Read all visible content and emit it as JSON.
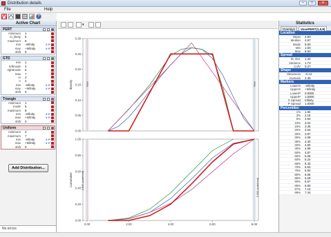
{
  "window": {
    "title": "Distribution details",
    "controls": [
      "–",
      "□",
      "✕"
    ]
  },
  "menu": {
    "items": [
      "File",
      "Help"
    ]
  },
  "toolbar": {
    "icons": [
      "red-curve-icon",
      "fit-icon",
      "book-icon",
      "table-icon",
      "chart-icon",
      "help-icon"
    ]
  },
  "left_panel": {
    "title": "Active Chart",
    "distributions": [
      {
        "name": "PERT",
        "selected": false,
        "color": "#2f63b6",
        "params": [
          {
            "label": "minimum",
            "value": "1"
          },
          {
            "label": "m_likely",
            "value": "5"
          },
          {
            "label": "maximum",
            "value": "8"
          },
          {
            "label": "min",
            "value": "-Infinity",
            "fx": true
          },
          {
            "label": "max",
            "value": "+Infinity",
            "fx": true
          },
          {
            "label": "shift",
            "value": "0"
          }
        ]
      },
      {
        "name": "GTD",
        "selected": false,
        "color": "#1a8f3c",
        "params": [
          {
            "label": "min",
            "value": "1"
          },
          {
            "label": "leftmode",
            "value": "4"
          },
          {
            "label": "rightmode",
            "value": "6"
          },
          {
            "label": "max",
            "value": "7"
          },
          {
            "label": "m",
            "value": "2"
          },
          {
            "label": "n",
            "value": "2"
          },
          {
            "label": "min",
            "value": "-Infinity",
            "fx": true
          },
          {
            "label": "max",
            "value": "+Infinity",
            "fx": true
          },
          {
            "label": "shift",
            "value": "0"
          }
        ]
      },
      {
        "name": "Triangle",
        "selected": false,
        "color": "#c0388a",
        "params": [
          {
            "label": "minimum",
            "value": "1"
          },
          {
            "label": "mode",
            "value": "5"
          },
          {
            "label": "maximum",
            "value": "8"
          },
          {
            "label": "min",
            "value": "-Infinity",
            "fx": true
          },
          {
            "label": "max",
            "value": "+Infinity",
            "fx": true
          },
          {
            "label": "shift",
            "value": "0"
          }
        ]
      },
      {
        "name": "Uniform",
        "selected": true,
        "color": "#d11a1a",
        "params": [
          {
            "label": "minimum",
            "value": "2"
          },
          {
            "label": "maximum",
            "value": "7"
          },
          {
            "label": "min",
            "value": "-Infinity",
            "fx": true
          },
          {
            "label": "max",
            "value": "+Infinity",
            "fx": true
          },
          {
            "label": "shift",
            "value": "0"
          }
        ]
      }
    ],
    "add_button": "Add Distribution...",
    "status": "No errors"
  },
  "chart_toolbar": {
    "icons": [
      "copy-icon",
      "print-icon",
      "edit-icon",
      "dropdown-icon",
      "stats-icon",
      "flag-icon"
    ]
  },
  "chart_data": [
    {
      "type": "line",
      "ylabel": "density",
      "xlim": [
        -0.2,
        8.2
      ],
      "ylim": [
        0,
        0.3
      ],
      "yticks": [
        "0.00",
        "0.05",
        "0.10",
        "0.15",
        "0.20",
        "0.25",
        "0.30"
      ],
      "grid": false,
      "series": [
        {
          "color": "#2f63b6",
          "x": [
            1,
            1.5,
            2,
            2.5,
            3,
            3.5,
            4,
            4.5,
            5,
            5.5,
            6,
            6.5,
            7,
            7.5,
            8
          ],
          "y": [
            0,
            0.015,
            0.045,
            0.085,
            0.13,
            0.175,
            0.215,
            0.25,
            0.27,
            0.265,
            0.235,
            0.18,
            0.11,
            0.04,
            0
          ]
        },
        {
          "color": "#1a8f3c",
          "x": [
            1,
            2,
            3,
            4,
            4.5,
            5,
            5.5,
            6,
            6.5,
            7
          ],
          "y": [
            0,
            0.07,
            0.15,
            0.245,
            0.265,
            0.27,
            0.265,
            0.245,
            0.14,
            0
          ]
        },
        {
          "color": "#c0388a",
          "x": [
            1,
            5,
            8
          ],
          "y": [
            0,
            0.286,
            0
          ]
        },
        {
          "color": "#d11a1a",
          "x": [
            1,
            2,
            4,
            6,
            7,
            8
          ],
          "y": [
            0,
            0,
            0.25,
            0.25,
            0,
            0
          ]
        }
      ]
    },
    {
      "type": "line",
      "ylabel": "cumulative",
      "xlim": [
        -0.2,
        8.2
      ],
      "ylim": [
        0,
        1
      ],
      "yticks": [
        "0.00",
        "0.20",
        "0.40",
        "0.60",
        "0.80",
        "1.00"
      ],
      "xticks": [
        "0.00",
        "2.00",
        "4.00",
        "6.00",
        "8.00"
      ],
      "grid": false,
      "series": [
        {
          "color": "#2f63b6",
          "x": [
            1,
            2,
            3,
            4,
            5,
            6,
            7,
            8
          ],
          "y": [
            0,
            0.02,
            0.1,
            0.27,
            0.51,
            0.77,
            0.95,
            1
          ]
        },
        {
          "color": "#1a8f3c",
          "x": [
            1,
            2,
            3,
            4,
            5,
            6,
            7
          ],
          "y": [
            0,
            0.03,
            0.14,
            0.34,
            0.6,
            0.86,
            1
          ]
        },
        {
          "color": "#c0388a",
          "x": [
            1,
            2,
            3,
            4,
            5,
            6,
            7,
            8
          ],
          "y": [
            0,
            0.02,
            0.1,
            0.21,
            0.38,
            0.6,
            0.82,
            1
          ]
        },
        {
          "color": "#d11a1a",
          "x": [
            1,
            2,
            3,
            4,
            5,
            6,
            7,
            8
          ],
          "y": [
            0,
            0,
            0.06,
            0.2,
            0.45,
            0.72,
            0.94,
            1
          ]
        }
      ]
    }
  ],
  "chart_markers": {
    "left": "0.000 (undefined)",
    "right": "9.000 (undefined)",
    "left_small": "Mean",
    "right_small": "Mean"
  },
  "right_panel": {
    "title": "Statistics",
    "tabs": [
      "Overlays",
      "VosePERT(1,5,8)"
    ],
    "sections": [
      {
        "name": "Location",
        "rows": [
          {
            "label": "Mean",
            "value": "4.83"
          },
          {
            "label": "Median",
            "value": "4.87"
          },
          {
            "label": "Mode",
            "value": "5.00"
          },
          {
            "label": "Min",
            "value": "1.00"
          },
          {
            "label": "Max",
            "value": "8.00"
          }
        ]
      },
      {
        "name": "Spread",
        "rows": [
          {
            "label": "St. dev.",
            "value": "1.32"
          },
          {
            "label": "Variance",
            "value": "1.73"
          },
          {
            "label": "CofV",
            "value": "0.27"
          }
        ]
      },
      {
        "name": "Shape",
        "rows": [
          {
            "label": "Skewness",
            "value": "-0.13"
          },
          {
            "label": "Kurtosis",
            "value": "2.35"
          }
        ]
      },
      {
        "name": "Markers",
        "rows": [
          {
            "label": "LowerX",
            "value": "-Infinity"
          },
          {
            "label": "UpperX",
            "value": "+Infinity"
          },
          {
            "label": "LowerP",
            "value": "0.0000"
          },
          {
            "label": "UpperP",
            "value": "1.0000"
          },
          {
            "label": "X Spread",
            "value": "Infinity"
          },
          {
            "label": "P Spread",
            "value": "1.0000"
          }
        ]
      }
    ],
    "percentiles_title": "Percentiles",
    "percentiles": [
      {
        "label": "1%",
        "value": "1.94"
      },
      {
        "label": "3%",
        "value": "2.15"
      },
      {
        "label": "5%",
        "value": "2.60"
      },
      {
        "label": "10%",
        "value": "3.04"
      },
      {
        "label": "15%",
        "value": "3.36"
      },
      {
        "label": "20%",
        "value": "3.63"
      },
      {
        "label": "25%",
        "value": "3.87"
      },
      {
        "label": "30%",
        "value": "4.09"
      },
      {
        "label": "35%",
        "value": "4.30"
      },
      {
        "label": "40%",
        "value": "4.50"
      },
      {
        "label": "45%",
        "value": "4.69"
      },
      {
        "label": "50%",
        "value": "4.87"
      },
      {
        "label": "55%",
        "value": "5.06"
      },
      {
        "label": "60%",
        "value": "5.24"
      },
      {
        "label": "65%",
        "value": "5.43"
      },
      {
        "label": "70%",
        "value": "5.63"
      },
      {
        "label": "75%",
        "value": "5.83"
      },
      {
        "label": "80%",
        "value": "6.05"
      },
      {
        "label": "85%",
        "value": "6.29"
      },
      {
        "label": "90%",
        "value": "6.57"
      },
      {
        "label": "95%",
        "value": "6.93"
      },
      {
        "label": "97%",
        "value": "7.13"
      },
      {
        "label": "99%",
        "value": "7.44"
      }
    ]
  }
}
